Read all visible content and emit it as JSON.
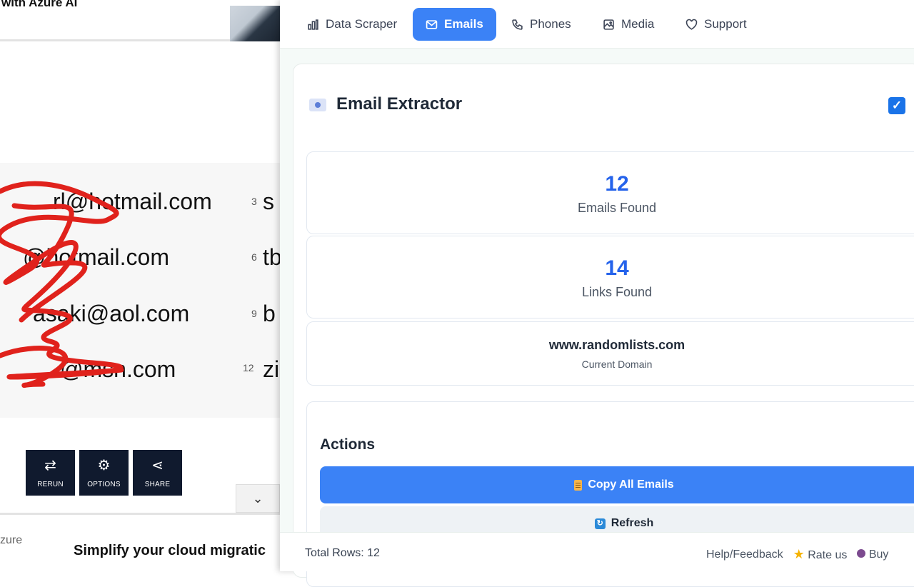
{
  "left": {
    "ad_title": "with Azure AI",
    "emails": [
      {
        "text": "rl@hotmail.com",
        "num": "3",
        "next": "s"
      },
      {
        "text": "@hotmail.com",
        "num": "6",
        "next": "tb"
      },
      {
        "text": "asaki@aol.com",
        "num": "9",
        "next": "b"
      },
      {
        "text": "@msn.com",
        "num": "12",
        "next": "zi"
      }
    ],
    "tools": [
      {
        "label": "RERUN",
        "icon": "shuffle-icon"
      },
      {
        "label": "OPTIONS",
        "icon": "gear-icon"
      },
      {
        "label": "SHARE",
        "icon": "share-icon"
      }
    ],
    "azure_label": "zure",
    "promo_title": "Simplify your cloud migratic",
    "scribble_color": "#e0221c"
  },
  "panel": {
    "tabs": [
      {
        "label": "Data Scraper",
        "icon": "chart-icon",
        "active": false
      },
      {
        "label": "Emails",
        "icon": "mail-icon",
        "active": true
      },
      {
        "label": "Phones",
        "icon": "phone-icon",
        "active": false
      },
      {
        "label": "Media",
        "icon": "image-icon",
        "active": false
      },
      {
        "label": "Support",
        "icon": "heart-icon",
        "active": false
      }
    ],
    "header": {
      "title": "Email Extractor",
      "checked": true
    },
    "stats": {
      "emails_count": "12",
      "emails_label": "Emails Found",
      "links_count": "14",
      "links_label": "Links Found",
      "domain": "www.randomlists.com",
      "domain_label": "Current Domain"
    },
    "actions": {
      "title": "Actions",
      "copy_label": "Copy All Emails",
      "refresh_label": "Refresh"
    },
    "footer": {
      "rows": "Total Rows: 12",
      "help": "Help/Feedback",
      "rate": "Rate us",
      "buy": "Buy"
    },
    "accent": "#3b82f6",
    "stat_color": "#2563eb"
  }
}
